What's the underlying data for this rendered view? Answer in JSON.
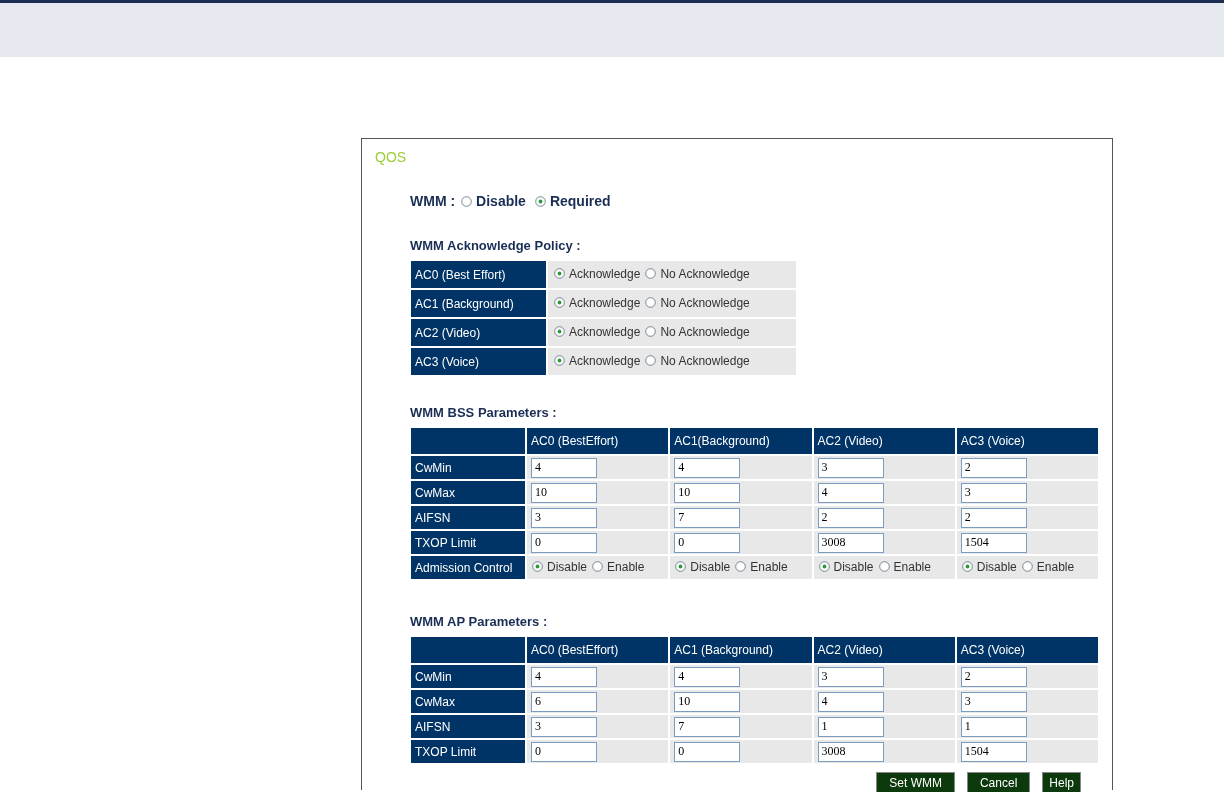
{
  "title": "QOS",
  "wmm": {
    "label": "WMM :",
    "options": [
      {
        "label": "Disable",
        "selected": false
      },
      {
        "label": "Required",
        "selected": true
      }
    ]
  },
  "ack_policy": {
    "heading": "WMM Acknowledge Policy :",
    "rows": [
      {
        "label": "AC0 (Best Effort)",
        "options": [
          {
            "label": "Acknowledge",
            "selected": true
          },
          {
            "label": "No Acknowledge",
            "selected": false
          }
        ]
      },
      {
        "label": "AC1 (Background)",
        "options": [
          {
            "label": "Acknowledge",
            "selected": true
          },
          {
            "label": "No Acknowledge",
            "selected": false
          }
        ]
      },
      {
        "label": "AC2 (Video)",
        "options": [
          {
            "label": "Acknowledge",
            "selected": true
          },
          {
            "label": "No Acknowledge",
            "selected": false
          }
        ]
      },
      {
        "label": "AC3 (Voice)",
        "options": [
          {
            "label": "Acknowledge",
            "selected": true
          },
          {
            "label": "No Acknowledge",
            "selected": false
          }
        ]
      }
    ]
  },
  "bss": {
    "heading": "WMM BSS Parameters :",
    "columns": [
      "AC0 (BestEffort)",
      "AC1(Background)",
      "AC2 (Video)",
      "AC3 (Voice)"
    ],
    "rows": [
      {
        "label": "CwMin",
        "kind": "inputs",
        "values": [
          "4",
          "4",
          "3",
          "2"
        ]
      },
      {
        "label": "CwMax",
        "kind": "inputs",
        "values": [
          "10",
          "10",
          "4",
          "3"
        ]
      },
      {
        "label": "AIFSN",
        "kind": "inputs",
        "values": [
          "3",
          "7",
          "2",
          "2"
        ]
      },
      {
        "label": "TXOP Limit",
        "kind": "inputs",
        "values": [
          "0",
          "0",
          "3008",
          "1504"
        ]
      },
      {
        "label": "Admission Control",
        "kind": "radios",
        "cells": [
          [
            {
              "label": "Disable",
              "selected": true
            },
            {
              "label": "Enable",
              "selected": false
            }
          ],
          [
            {
              "label": "Disable",
              "selected": true
            },
            {
              "label": "Enable",
              "selected": false
            }
          ],
          [
            {
              "label": "Disable",
              "selected": true
            },
            {
              "label": "Enable",
              "selected": false
            }
          ],
          [
            {
              "label": "Disable",
              "selected": true
            },
            {
              "label": "Enable",
              "selected": false
            }
          ]
        ]
      }
    ]
  },
  "ap": {
    "heading": "WMM AP Parameters :",
    "columns": [
      "AC0 (BestEffort)",
      "AC1 (Background)",
      "AC2 (Video)",
      "AC3 (Voice)"
    ],
    "rows": [
      {
        "label": "CwMin",
        "kind": "inputs",
        "values": [
          "4",
          "4",
          "3",
          "2"
        ]
      },
      {
        "label": "CwMax",
        "kind": "inputs",
        "values": [
          "6",
          "10",
          "4",
          "3"
        ]
      },
      {
        "label": "AIFSN",
        "kind": "inputs",
        "values": [
          "3",
          "7",
          "1",
          "1"
        ]
      },
      {
        "label": "TXOP Limit",
        "kind": "inputs",
        "values": [
          "0",
          "0",
          "3008",
          "1504"
        ]
      }
    ]
  },
  "buttons": [
    "Set WMM",
    "Cancel",
    "Help"
  ]
}
